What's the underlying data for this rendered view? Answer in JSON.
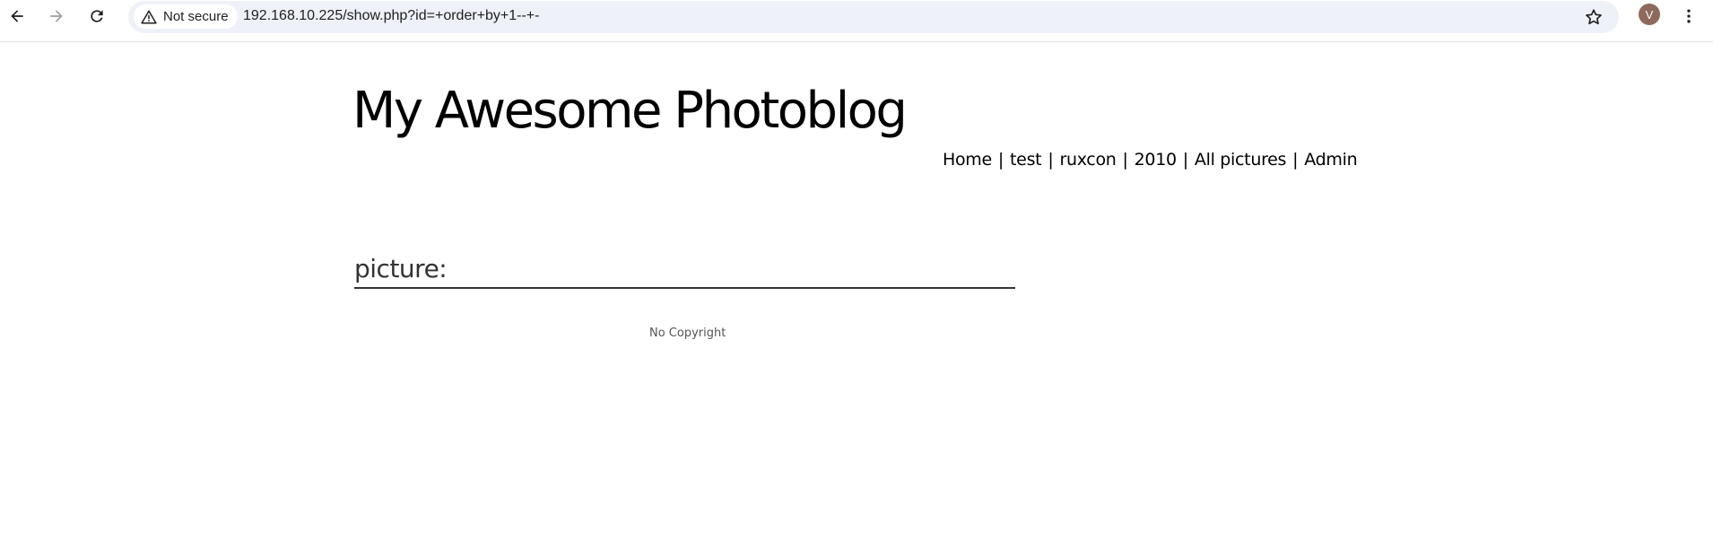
{
  "browser": {
    "security_label": "Not secure",
    "url": "192.168.10.225/show.php?id=+order+by+1--+-",
    "avatar_initial": "V"
  },
  "site": {
    "title": "My Awesome Photoblog",
    "nav": [
      {
        "label": "Home"
      },
      {
        "label": "test"
      },
      {
        "label": "ruxcon"
      },
      {
        "label": "2010"
      },
      {
        "label": "All pictures"
      },
      {
        "label": "Admin"
      }
    ],
    "nav_separator": "|"
  },
  "content": {
    "heading": "picture:"
  },
  "footer": {
    "text": "No Copyright"
  }
}
